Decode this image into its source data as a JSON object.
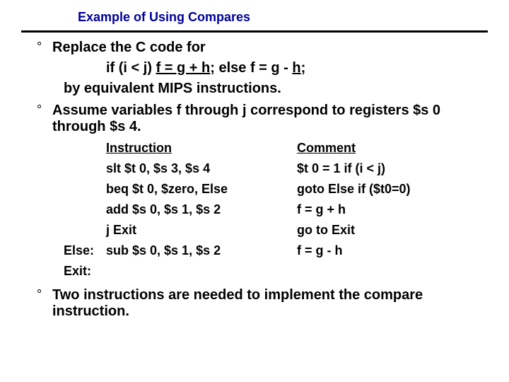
{
  "title": "Example of Using Compares",
  "b1": "Replace the C code for",
  "code_pre": "if (i < j) ",
  "code_u1": "f = g +  h",
  "code_mid": "; else f = g  - ",
  "code_u2": "h",
  "code_post": ";",
  "sub1": "by equivalent MIPS instructions.",
  "b2": "Assume variables f through j correspond to registers $s 0 through $s 4.",
  "th_instr": "Instruction",
  "th_cmt": "Comment",
  "rows": [
    {
      "label": "",
      "instr": "slt $t 0, $s 3, $s 4",
      "cmt": "$t 0 = 1 if (i < j)"
    },
    {
      "label": "",
      "instr": "beq $t 0, $zero, Else",
      "cmt": "goto Else  if ($t0=0)"
    },
    {
      "label": "",
      "instr": "add $s 0, $s 1, $s 2",
      "cmt": "f = g + h"
    },
    {
      "label": "",
      "instr": "j Exit",
      "cmt": "go to Exit"
    },
    {
      "label": "Else:",
      "instr": "sub $s 0, $s 1, $s 2",
      "cmt": "f = g - h"
    },
    {
      "label": "Exit:",
      "instr": "",
      "cmt": ""
    }
  ],
  "b3": "Two instructions are needed to implement the compare instruction."
}
